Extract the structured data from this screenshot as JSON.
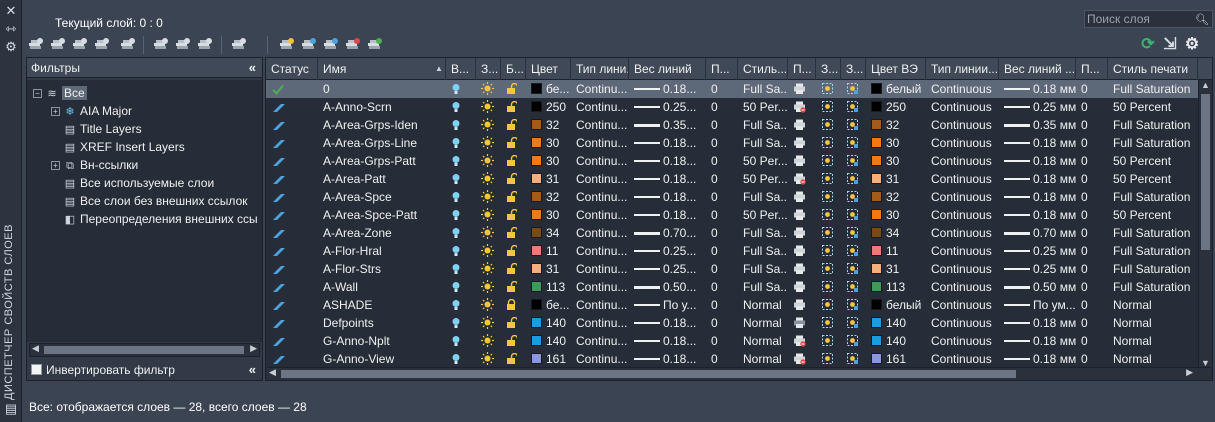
{
  "palette_title": "ДИСПЕТЧЕР СВОЙСТВ СЛОЕВ",
  "current_layer": "Текущий слой: 0 : 0",
  "search_placeholder": "Поиск слоя",
  "filters": {
    "header": "Фильтры",
    "tree": [
      {
        "label": "Все",
        "level": 0,
        "toggle": "−",
        "icon": "layers-stack-icon",
        "selected": true
      },
      {
        "label": "AIA Major",
        "level": 1,
        "toggle": "+",
        "icon": "snowflake-filter-icon"
      },
      {
        "label": "Title Layers",
        "level": 1,
        "toggle": "",
        "icon": "property-filter-icon"
      },
      {
        "label": "XREF Insert Layers",
        "level": 1,
        "toggle": "",
        "icon": "property-filter-icon"
      },
      {
        "label": "Вн-ссылки",
        "level": 1,
        "toggle": "+",
        "icon": "xref-filter-icon"
      },
      {
        "label": "Все используемые слои",
        "level": 1,
        "toggle": "",
        "icon": "property-filter-icon"
      },
      {
        "label": "Все слои без внешних ссылок",
        "level": 1,
        "toggle": "",
        "icon": "property-filter-icon"
      },
      {
        "label": "Переопределения внешних ссы",
        "level": 1,
        "toggle": "",
        "icon": "override-filter-icon"
      }
    ],
    "invert_label": "Инвертировать фильтр"
  },
  "columns": [
    "Статус",
    "Имя",
    "В...",
    "З...",
    "Б...",
    "Цвет",
    "Тип лини...",
    "Вес линий",
    "П...",
    "Стиль...",
    "П...",
    "З...",
    "З...",
    "Цвет ВЭ",
    "Тип линии...",
    "Вес линий ...",
    "П...",
    "Стиль печати"
  ],
  "colors": {
    "accent_selected_row": "#5d6878",
    "status_current": "#4caf50",
    "status_layer": "#4aa3df",
    "refresh": "#3cb371"
  },
  "rows": [
    {
      "current": true,
      "name": "0",
      "color_hex": "#000000",
      "color": "бе...",
      "linetype": "Continu...",
      "lw": "0.18...",
      "lw_style": "thin",
      "transp": "0",
      "plotstyle": "Full Sa...",
      "plot_no": false,
      "vp_color_hex": "#000000",
      "vp_color": "белый",
      "vp_linetype": "Continuous",
      "vp_lw": "0.18 мм",
      "vp_lw_style": "thin",
      "vp_transp": "0",
      "vp_plotstyle": "Full Saturation",
      "locked": false
    },
    {
      "current": false,
      "name": "A-Anno-Scrn",
      "color_hex": "#000000",
      "color": "250",
      "linetype": "Continu...",
      "lw": "0.25...",
      "lw_style": "thin",
      "transp": "0",
      "plotstyle": "50 Per...",
      "plot_no": true,
      "vp_color_hex": "#000000",
      "vp_color": "250",
      "vp_linetype": "Continuous",
      "vp_lw": "0.25 мм",
      "vp_lw_style": "thin",
      "vp_transp": "0",
      "vp_plotstyle": "50 Percent",
      "locked": false
    },
    {
      "current": false,
      "name": "A-Area-Grps-Iden",
      "color_hex": "#a15b1a",
      "color": "32",
      "linetype": "Continu...",
      "lw": "0.35...",
      "lw_style": "thick",
      "transp": "0",
      "plotstyle": "Full Sa...",
      "plot_no": false,
      "vp_color_hex": "#a15b1a",
      "vp_color": "32",
      "vp_linetype": "Continuous",
      "vp_lw": "0.35 мм",
      "vp_lw_style": "thick",
      "vp_transp": "0",
      "vp_plotstyle": "Full Saturation",
      "locked": false
    },
    {
      "current": false,
      "name": "A-Area-Grps-Line",
      "color_hex": "#f07a14",
      "color": "30",
      "linetype": "Continu...",
      "lw": "0.18...",
      "lw_style": "thin",
      "transp": "0",
      "plotstyle": "Full Sa...",
      "plot_no": false,
      "vp_color_hex": "#f07a14",
      "vp_color": "30",
      "vp_linetype": "Continuous",
      "vp_lw": "0.18 мм",
      "vp_lw_style": "thin",
      "vp_transp": "0",
      "vp_plotstyle": "Full Saturation",
      "locked": false
    },
    {
      "current": false,
      "name": "A-Area-Grps-Patt",
      "color_hex": "#f07a14",
      "color": "30",
      "linetype": "Continu...",
      "lw": "0.18...",
      "lw_style": "thin",
      "transp": "0",
      "plotstyle": "50 Per...",
      "plot_no": false,
      "vp_color_hex": "#f07a14",
      "vp_color": "30",
      "vp_linetype": "Continuous",
      "vp_lw": "0.18 мм",
      "vp_lw_style": "thin",
      "vp_transp": "0",
      "vp_plotstyle": "50 Percent",
      "locked": false
    },
    {
      "current": false,
      "name": "A-Area-Patt",
      "color_hex": "#f3b07c",
      "color": "31",
      "linetype": "Continu...",
      "lw": "0.18...",
      "lw_style": "thin",
      "transp": "0",
      "plotstyle": "50 Per...",
      "plot_no": true,
      "vp_color_hex": "#f3b07c",
      "vp_color": "31",
      "vp_linetype": "Continuous",
      "vp_lw": "0.18 мм",
      "vp_lw_style": "thin",
      "vp_transp": "0",
      "vp_plotstyle": "50 Percent",
      "locked": false
    },
    {
      "current": false,
      "name": "A-Area-Spce",
      "color_hex": "#a15b1a",
      "color": "32",
      "linetype": "Continu...",
      "lw": "0.18...",
      "lw_style": "thin",
      "transp": "0",
      "plotstyle": "Full Sa...",
      "plot_no": false,
      "vp_color_hex": "#a15b1a",
      "vp_color": "32",
      "vp_linetype": "Continuous",
      "vp_lw": "0.18 мм",
      "vp_lw_style": "thin",
      "vp_transp": "0",
      "vp_plotstyle": "Full Saturation",
      "locked": false
    },
    {
      "current": false,
      "name": "A-Area-Spce-Patt",
      "color_hex": "#f07a14",
      "color": "30",
      "linetype": "Continu...",
      "lw": "0.18...",
      "lw_style": "thin",
      "transp": "0",
      "plotstyle": "50 Per...",
      "plot_no": false,
      "vp_color_hex": "#f07a14",
      "vp_color": "30",
      "vp_linetype": "Continuous",
      "vp_lw": "0.18 мм",
      "vp_lw_style": "thin",
      "vp_transp": "0",
      "vp_plotstyle": "50 Percent",
      "locked": false
    },
    {
      "current": false,
      "name": "A-Area-Zone",
      "color_hex": "#7a4a14",
      "color": "34",
      "linetype": "Continu...",
      "lw": "0.70...",
      "lw_style": "thick",
      "transp": "0",
      "plotstyle": "Full Sa...",
      "plot_no": false,
      "vp_color_hex": "#7a4a14",
      "vp_color": "34",
      "vp_linetype": "Continuous",
      "vp_lw": "0.70 мм",
      "vp_lw_style": "thick",
      "vp_transp": "0",
      "vp_plotstyle": "Full Saturation",
      "locked": false
    },
    {
      "current": false,
      "name": "A-Flor-Hral",
      "color_hex": "#f07878",
      "color": "11",
      "linetype": "Continu...",
      "lw": "0.25...",
      "lw_style": "thin",
      "transp": "0",
      "plotstyle": "Full Sa...",
      "plot_no": false,
      "vp_color_hex": "#f07878",
      "vp_color": "11",
      "vp_linetype": "Continuous",
      "vp_lw": "0.25 мм",
      "vp_lw_style": "thin",
      "vp_transp": "0",
      "vp_plotstyle": "Full Saturation",
      "locked": false
    },
    {
      "current": false,
      "name": "A-Flor-Strs",
      "color_hex": "#f3b07c",
      "color": "31",
      "linetype": "Continu...",
      "lw": "0.25...",
      "lw_style": "thin",
      "transp": "0",
      "plotstyle": "Full Sa...",
      "plot_no": false,
      "vp_color_hex": "#f3b07c",
      "vp_color": "31",
      "vp_linetype": "Continuous",
      "vp_lw": "0.25 мм",
      "vp_lw_style": "thin",
      "vp_transp": "0",
      "vp_plotstyle": "Full Saturation",
      "locked": false
    },
    {
      "current": false,
      "name": "A-Wall",
      "color_hex": "#3e9a5a",
      "color": "113",
      "linetype": "Continu...",
      "lw": "0.50...",
      "lw_style": "thick",
      "transp": "0",
      "plotstyle": "Full Sa...",
      "plot_no": false,
      "vp_color_hex": "#3e9a5a",
      "vp_color": "113",
      "vp_linetype": "Continuous",
      "vp_lw": "0.50 мм",
      "vp_lw_style": "thick",
      "vp_transp": "0",
      "vp_plotstyle": "Full Saturation",
      "locked": false
    },
    {
      "current": false,
      "name": "ASHADE",
      "color_hex": "#000000",
      "color": "бе...",
      "linetype": "Continu...",
      "lw": "По у...",
      "lw_style": "thin",
      "transp": "0",
      "plotstyle": "Normal",
      "plot_no": false,
      "vp_color_hex": "#000000",
      "vp_color": "белый",
      "vp_linetype": "Continuous",
      "vp_lw": "По ум...",
      "vp_lw_style": "thin",
      "vp_transp": "0",
      "vp_plotstyle": "Normal",
      "locked": true
    },
    {
      "current": false,
      "name": "Defpoints",
      "color_hex": "#1a9ce0",
      "color": "140",
      "linetype": "Continu...",
      "lw": "0.18...",
      "lw_style": "thin",
      "transp": "0",
      "plotstyle": "Normal",
      "plot_no": false,
      "plot_gray": true,
      "vp_color_hex": "#1a9ce0",
      "vp_color": "140",
      "vp_linetype": "Continuous",
      "vp_lw": "0.18 мм",
      "vp_lw_style": "thin",
      "vp_transp": "0",
      "vp_plotstyle": "Normal",
      "locked": false
    },
    {
      "current": false,
      "name": "G-Anno-Nplt",
      "color_hex": "#1a9ce0",
      "color": "140",
      "linetype": "Continu...",
      "lw": "0.18...",
      "lw_style": "thin",
      "transp": "0",
      "plotstyle": "Normal",
      "plot_no": true,
      "vp_color_hex": "#1a9ce0",
      "vp_color": "140",
      "vp_linetype": "Continuous",
      "vp_lw": "0.18 мм",
      "vp_lw_style": "thin",
      "vp_transp": "0",
      "vp_plotstyle": "Normal",
      "locked": false
    },
    {
      "current": false,
      "name": "G-Anno-View",
      "color_hex": "#8a96e0",
      "color": "161",
      "linetype": "Continu...",
      "lw": "0.18...",
      "lw_style": "thin",
      "transp": "0",
      "plotstyle": "Normal",
      "plot_no": true,
      "vp_color_hex": "#8a96e0",
      "vp_color": "161",
      "vp_linetype": "Continuous",
      "vp_lw": "0.18 мм",
      "vp_lw_style": "thin",
      "vp_transp": "0",
      "vp_plotstyle": "Normal",
      "locked": false
    }
  ],
  "status_bar": "Все: отображается слоев — 28, всего слоев — 28"
}
